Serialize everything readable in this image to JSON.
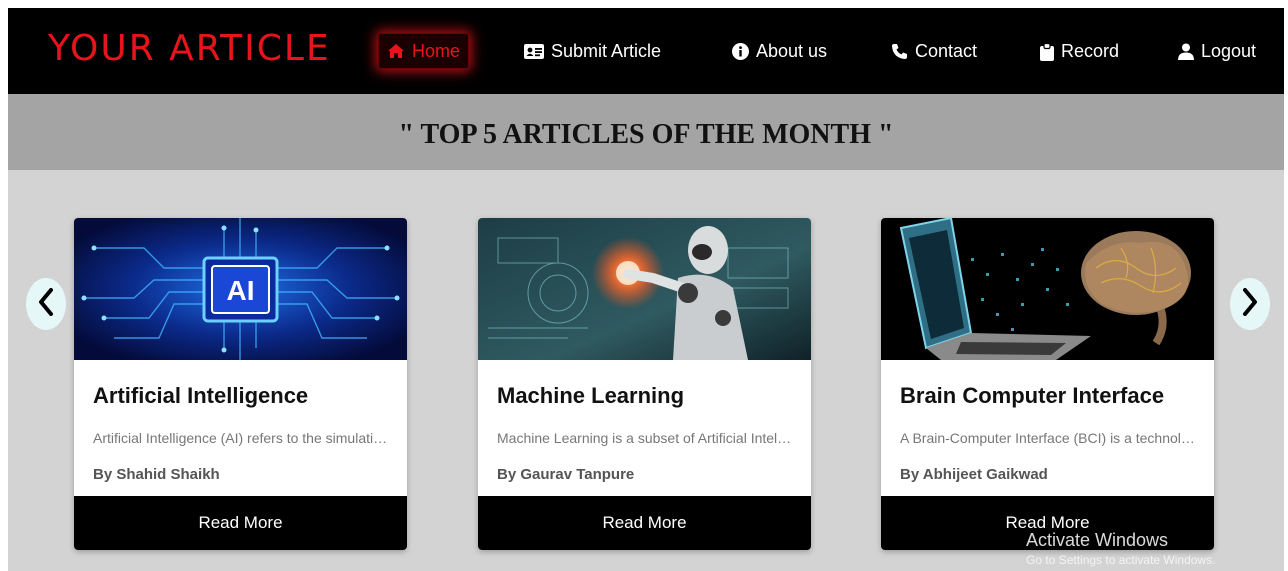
{
  "nav": {
    "brand": "YOUR ARTICLE",
    "items": [
      {
        "label": "Home",
        "icon": "home-icon",
        "active": true
      },
      {
        "label": "Submit Article",
        "icon": "id-card-icon"
      },
      {
        "label": "About us",
        "icon": "info-circle-icon"
      },
      {
        "label": "Contact",
        "icon": "phone-icon"
      },
      {
        "label": "Record",
        "icon": "clipboard-icon"
      },
      {
        "label": "Logout",
        "icon": "user-icon"
      }
    ],
    "accent_color": "#e8141c"
  },
  "page": {
    "title": "\" TOP 5 ARTICLES OF THE MONTH \""
  },
  "carousel": {
    "prev_icon": "chevron-left-icon",
    "next_icon": "chevron-right-icon",
    "cards": [
      {
        "title": "Artificial Intelligence",
        "description": "Artificial Intelligence (AI) refers to the simulation of human intelligence in machines",
        "author": "By Shahid Shaikh",
        "button": "Read More",
        "image": "ai-chip-image"
      },
      {
        "title": "Machine Learning",
        "description": "Machine Learning is a subset of Artificial Intelligence that enables systems to learn",
        "author": "By Gaurav Tanpure",
        "button": "Read More",
        "image": "robot-touchscreen-image"
      },
      {
        "title": "Brain Computer Interface",
        "description": "A Brain-Computer Interface (BCI) is a technology that enables direct communication",
        "author": "By Abhijeet Gaikwad",
        "button": "Read More",
        "image": "laptop-brain-image"
      }
    ]
  },
  "watermark": {
    "line1": "Activate Windows",
    "line2": "Go to Settings to activate Windows."
  }
}
